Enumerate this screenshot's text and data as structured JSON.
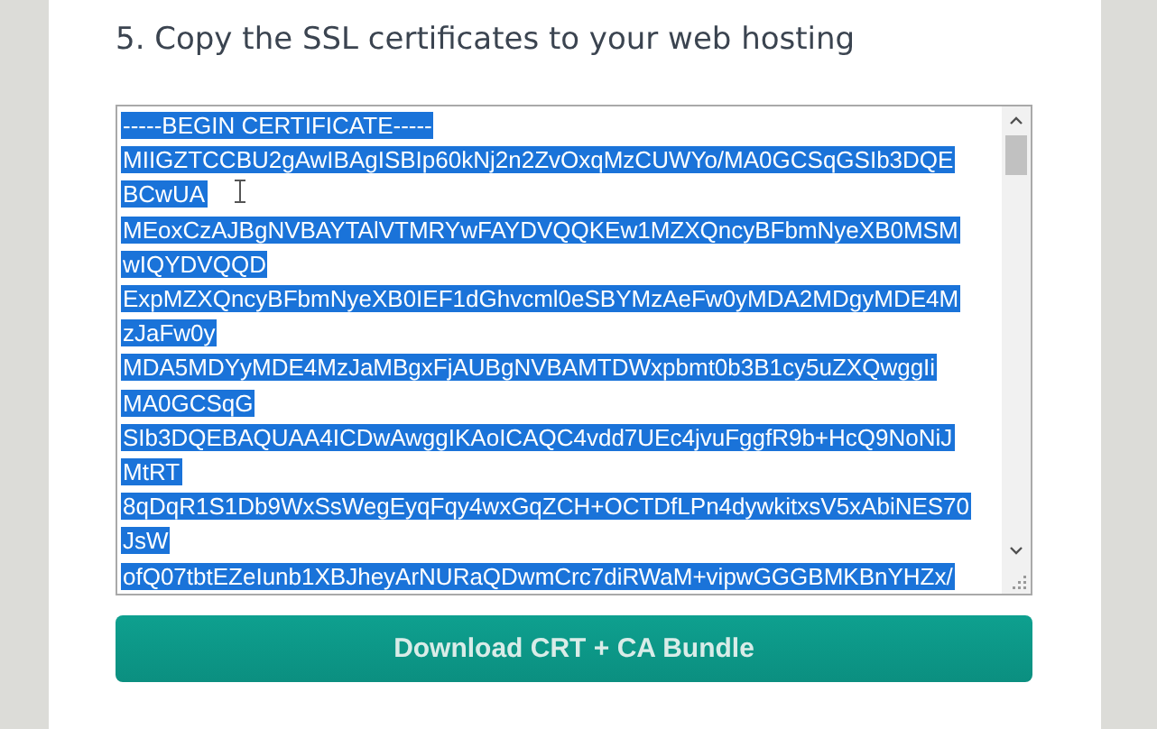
{
  "heading": "5. Copy the SSL certificates to your web hosting",
  "certificate": {
    "selected": true,
    "rows": [
      "-----BEGIN CERTIFICATE-----",
      "MIIGZTCCBU2gAwIBAgISBIp60kNj2n2ZvOxqMzCUWYo/MA0GCSqGSIb3DQE",
      "BCwUA",
      "MEoxCzAJBgNVBAYTAlVTMRYwFAYDVQQKEw1MZXQncyBFbmNyeXB0MSM",
      "wIQYDVQQD",
      "ExpMZXQncyBFbmNyeXB0IEF1dGhvcml0eSBYMzAeFw0yMDA2MDgyMDE4M",
      "zJaFw0y",
      "MDA5MDYyMDE4MzJaMBgxFjAUBgNVBAMTDWxpbmt0b3B1cy5uZXQwggIi",
      "MA0GCSqG",
      "SIb3DQEBAQUAA4ICDwAwggIKAoICAQC4vdd7UEc4jvuFggfR9b+HcQ9NoNiJ",
      "MtRT",
      "8qDqR1S1Db9WxSsWegEyqFqy4wxGqZCH+OCTDfLPn4dywkitxsV5xAbiNES70",
      "JsW",
      "ofQ07tbtEZeIunb1XBJheyArNURaQDwmCrc7diRWaM+vipwGGGBMKBnYHZx/"
    ]
  },
  "button": "Download CRT + CA Bundle"
}
